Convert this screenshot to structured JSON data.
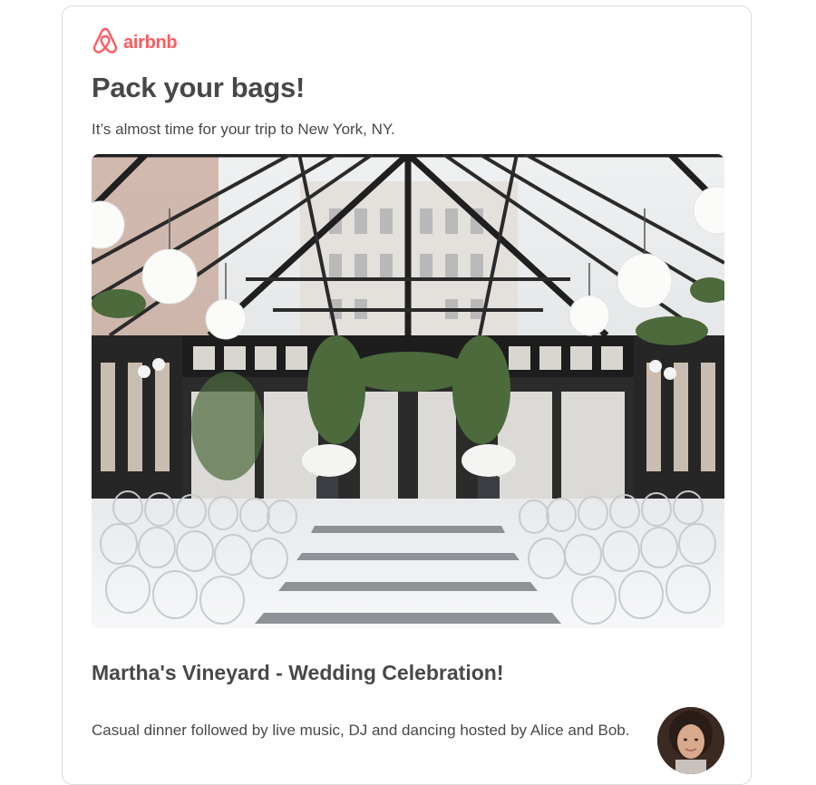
{
  "brand": {
    "name": "airbnb",
    "icon": "airbnb-belo-icon",
    "color": "#ff5a5f"
  },
  "email": {
    "title": "Pack your bags!",
    "subtitle": "It’s almost time for your trip to New York, NY."
  },
  "hero_image": {
    "alt": "Glass conservatory wedding venue with white chairs and floral arch"
  },
  "event": {
    "title": "Martha's Vineyard - Wedding Celebration!",
    "description": "Casual dinner followed by live music, DJ and dancing hosted by Alice and Bob."
  },
  "host": {
    "avatar_icon": "host-avatar"
  }
}
